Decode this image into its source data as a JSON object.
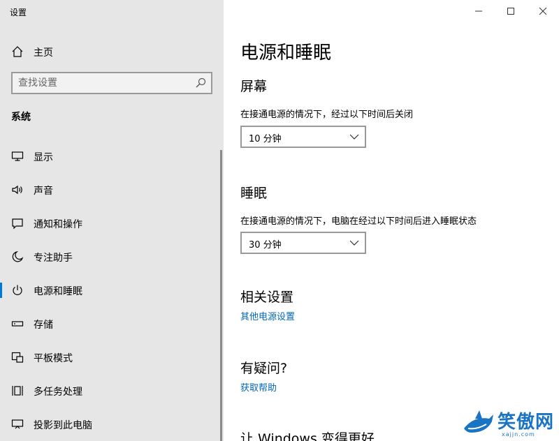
{
  "window": {
    "title": "设置",
    "controls": [
      "minimize-icon",
      "maximize-icon",
      "close-icon"
    ]
  },
  "sidebar": {
    "home_label": "主页",
    "search": {
      "placeholder": "查找设置"
    },
    "section_title": "系统",
    "items": [
      {
        "label": "显示",
        "icon": "display-icon",
        "active": false
      },
      {
        "label": "声音",
        "icon": "speaker-icon",
        "active": false
      },
      {
        "label": "通知和操作",
        "icon": "notification-icon",
        "active": false
      },
      {
        "label": "专注助手",
        "icon": "moon-icon",
        "active": false
      },
      {
        "label": "电源和睡眠",
        "icon": "power-icon",
        "active": true
      },
      {
        "label": "存储",
        "icon": "storage-icon",
        "active": false
      },
      {
        "label": "平板模式",
        "icon": "tablet-icon",
        "active": false
      },
      {
        "label": "多任务处理",
        "icon": "multitask-icon",
        "active": false
      },
      {
        "label": "投影到此电脑",
        "icon": "project-icon",
        "active": false
      }
    ]
  },
  "main": {
    "title": "电源和睡眠",
    "screen": {
      "heading": "屏幕",
      "description": "在接通电源的情况下，经过以下时间后关闭",
      "value": "10 分钟"
    },
    "sleep": {
      "heading": "睡眠",
      "description": "在接通电源的情况下，电脑在经过以下时间后进入睡眠状态",
      "value": "30 分钟"
    },
    "related": {
      "heading": "相关设置",
      "link": "其他电源设置"
    },
    "questions": {
      "heading": "有疑问?",
      "link": "获取帮助"
    },
    "improve": {
      "heading": "让 Windows 变得更好"
    }
  },
  "watermark": {
    "text": "笑傲网",
    "sub": "xajjn.com"
  },
  "colors": {
    "sidebar_bg": "#e6e6e6",
    "accent": "#0078d7",
    "link": "#0067b8"
  }
}
